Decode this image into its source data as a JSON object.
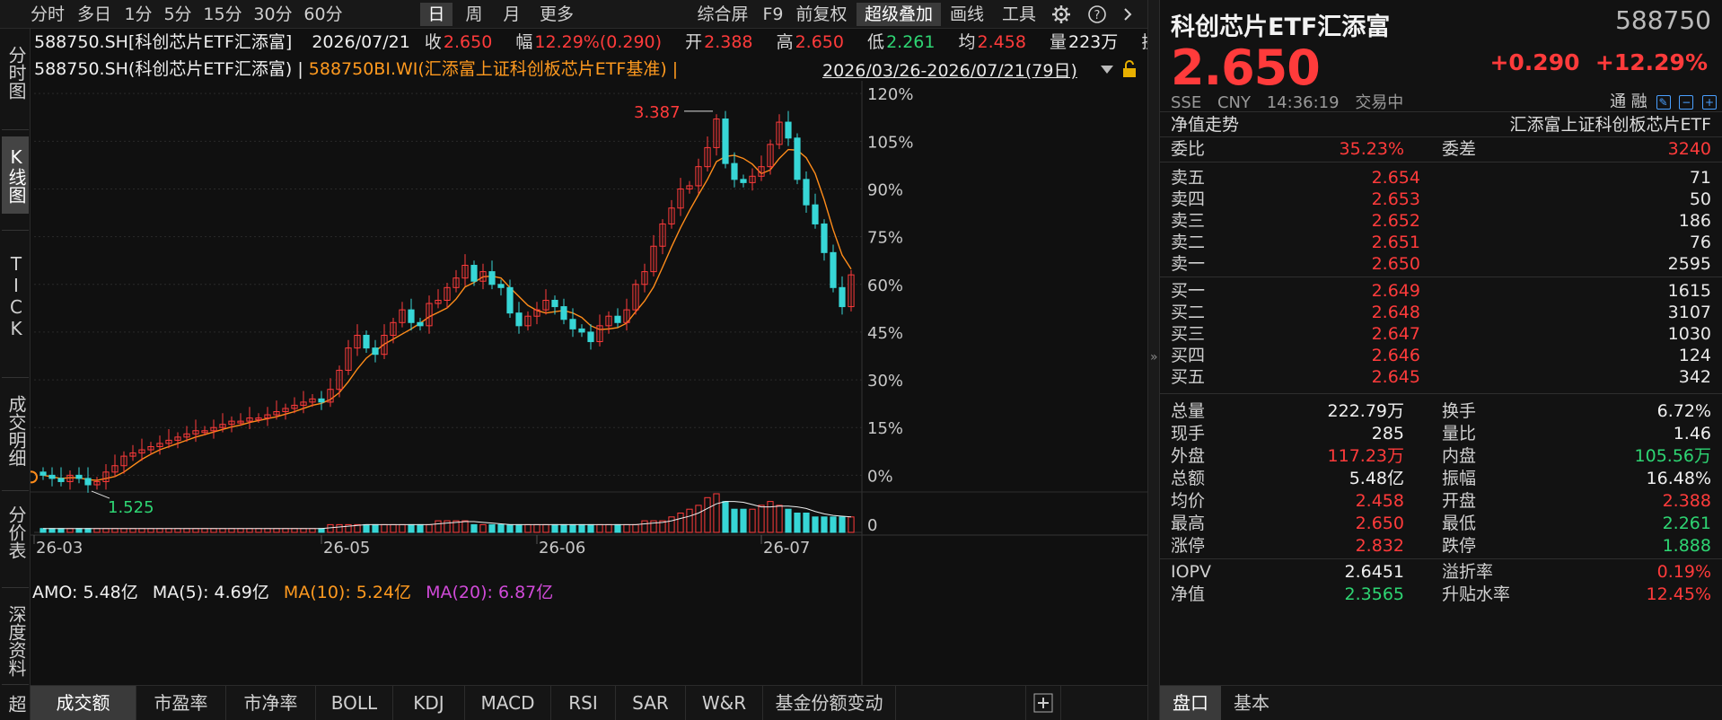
{
  "toolbar": {
    "periods": [
      "分时",
      "多日",
      "1分",
      "5分",
      "15分",
      "30分",
      "60分",
      "日",
      "周",
      "月",
      "更多"
    ],
    "active_period": "日",
    "tools": [
      "综合屏",
      "F9",
      "前复权",
      "超级叠加",
      "画线",
      "工具"
    ],
    "active_tool": "超级叠加"
  },
  "sidenav": {
    "items": [
      "分时图",
      "K线图",
      "TICK",
      "成交明细",
      "分价表",
      "深度资料",
      "超级"
    ],
    "active": "K线图"
  },
  "info": {
    "code_name": "588750.SH[科创芯片ETF汇添富]",
    "date": "2026/07/21",
    "close_label": "收",
    "close": "2.650",
    "range_label": "幅",
    "range": "12.29%(0.290)",
    "open_label": "开",
    "open": "2.388",
    "high_label": "高",
    "high": "2.650",
    "low_label": "低",
    "low": "2.261",
    "avg_label": "均",
    "avg": "2.458",
    "vol_label": "量",
    "vol": "223万",
    "turn_label": "换",
    "overlay_main": "588750.SH(科创芯片ETF汇添富) |",
    "overlay_bench": "588750BI.WI(汇添富上证科创板芯片ETF基准) |",
    "date_range": "2026/03/26-2026/07/21(79日)"
  },
  "amo": {
    "amo": "AMO: 5.48亿",
    "ma5": "MA(5): 4.69亿",
    "ma10": "MA(10): 5.24亿",
    "ma20": "MA(20): 6.87亿"
  },
  "bottom_tabs": [
    "成交额",
    "市盈率",
    "市净率",
    "BOLL",
    "KDJ",
    "MACD",
    "RSI",
    "SAR",
    "W&R",
    "基金份额变动"
  ],
  "bottom_active": "成交额",
  "chart_data": {
    "type": "candlestick",
    "y_axis_labels": [
      "120%",
      "105%",
      "90%",
      "75%",
      "60%",
      "45%",
      "30%",
      "15%",
      "0%"
    ],
    "y_range_pct": [
      -3,
      124
    ],
    "x_tick_labels": [
      "26-03",
      "26-05",
      "26-06",
      "26-07"
    ],
    "max_label": "3.387",
    "min_label": "1.525",
    "volume_axis_label": "0",
    "candles_close_pct": [
      0,
      -1,
      -2,
      0,
      -1,
      -3,
      -2,
      1,
      3,
      6,
      7,
      8,
      9,
      10,
      11,
      12,
      13,
      14,
      14,
      15,
      16,
      17,
      17,
      18,
      18,
      19,
      20,
      21,
      22,
      23,
      24,
      23,
      27,
      33,
      40,
      44,
      40,
      38,
      44,
      48,
      52,
      48,
      47,
      54,
      55,
      59,
      62,
      66,
      61,
      64,
      60,
      59,
      51,
      47,
      50,
      52,
      55,
      53,
      49,
      46,
      45,
      42,
      47,
      50,
      48,
      52,
      60,
      64,
      72,
      79,
      84,
      90,
      91,
      97,
      103,
      112,
      98,
      93,
      92,
      94,
      97,
      104,
      111,
      106,
      93,
      85,
      79,
      70,
      59,
      53,
      63
    ],
    "volume_rel": [
      1,
      1,
      1,
      1,
      1,
      1,
      1,
      1,
      1,
      1,
      1,
      1,
      1,
      1,
      1,
      1,
      1,
      1,
      1,
      1,
      1,
      1,
      1,
      1,
      1,
      1,
      1,
      1,
      1,
      1,
      1,
      1,
      2,
      2,
      2,
      2,
      2,
      2,
      2,
      2,
      2,
      2,
      2,
      2,
      3,
      3,
      3,
      3,
      2,
      2,
      2,
      2,
      2,
      2,
      2,
      2,
      2,
      2,
      2,
      2,
      2,
      2,
      2,
      2,
      2,
      2,
      2,
      3,
      3,
      3,
      4,
      5,
      6,
      7,
      9,
      10,
      8,
      6,
      6,
      6,
      7,
      8,
      7,
      6,
      5,
      5,
      4,
      4,
      4,
      4,
      4
    ]
  },
  "quote": {
    "name": "科创芯片ETF汇添富",
    "code": "588750",
    "price": "2.650",
    "change": "+0.290",
    "change_pct": "+12.29%",
    "market": "SSE",
    "currency": "CNY",
    "time": "14:36:19",
    "status": "交易中",
    "tags": "通 融",
    "net_label": "净值走势",
    "benchmark_name": "汇添富上证科创板芯片ETF",
    "weibi_label": "委比",
    "weibi": "35.23%",
    "weicha_label": "委差",
    "weicha": "3240",
    "asks": [
      {
        "label": "卖五",
        "price": "2.654",
        "vol": "71"
      },
      {
        "label": "卖四",
        "price": "2.653",
        "vol": "50"
      },
      {
        "label": "卖三",
        "price": "2.652",
        "vol": "186"
      },
      {
        "label": "卖二",
        "price": "2.651",
        "vol": "76"
      },
      {
        "label": "卖一",
        "price": "2.650",
        "vol": "2595"
      }
    ],
    "bids": [
      {
        "label": "买一",
        "price": "2.649",
        "vol": "1615"
      },
      {
        "label": "买二",
        "price": "2.648",
        "vol": "3107"
      },
      {
        "label": "买三",
        "price": "2.647",
        "vol": "1030"
      },
      {
        "label": "买四",
        "price": "2.646",
        "vol": "124"
      },
      {
        "label": "买五",
        "price": "2.645",
        "vol": "342"
      }
    ],
    "stats": [
      {
        "l1": "总量",
        "v1": "222.79万",
        "c1": "white",
        "l2": "换手",
        "v2": "6.72%",
        "c2": "white"
      },
      {
        "l1": "现手",
        "v1": "285",
        "c1": "white",
        "l2": "量比",
        "v2": "1.46",
        "c2": "white"
      },
      {
        "l1": "外盘",
        "v1": "117.23万",
        "c1": "up",
        "l2": "内盘",
        "v2": "105.56万",
        "c2": "down"
      },
      {
        "l1": "总额",
        "v1": "5.48亿",
        "c1": "white",
        "l2": "振幅",
        "v2": "16.48%",
        "c2": "white"
      },
      {
        "l1": "均价",
        "v1": "2.458",
        "c1": "up",
        "l2": "开盘",
        "v2": "2.388",
        "c2": "up"
      },
      {
        "l1": "最高",
        "v1": "2.650",
        "c1": "up",
        "l2": "最低",
        "v2": "2.261",
        "c2": "down"
      },
      {
        "l1": "涨停",
        "v1": "2.832",
        "c1": "up",
        "l2": "跌停",
        "v2": "1.888",
        "c2": "down"
      },
      {
        "l1": "IOPV",
        "v1": "2.6451",
        "c1": "white",
        "l2": "溢折率",
        "v2": "0.19%",
        "c2": "up"
      },
      {
        "l1": "净值",
        "v1": "2.3565",
        "c1": "down",
        "l2": "升贴水率",
        "v2": "12.45%",
        "c2": "up"
      }
    ],
    "panel_tabs": [
      "盘口",
      "基本"
    ],
    "panel_active": "盘口"
  },
  "colors": {
    "up": "#ff3b3b",
    "down": "#2ed573",
    "candle_down": "#37d6d6",
    "ma_line": "#ff8c1a",
    "grid": "#2a2a2a"
  },
  "icons": [
    "gear-icon",
    "help-icon",
    "chevron-right-icon",
    "lock-icon",
    "dropdown-arrow-icon",
    "plus-icon",
    "collapse-arrow-icon"
  ]
}
